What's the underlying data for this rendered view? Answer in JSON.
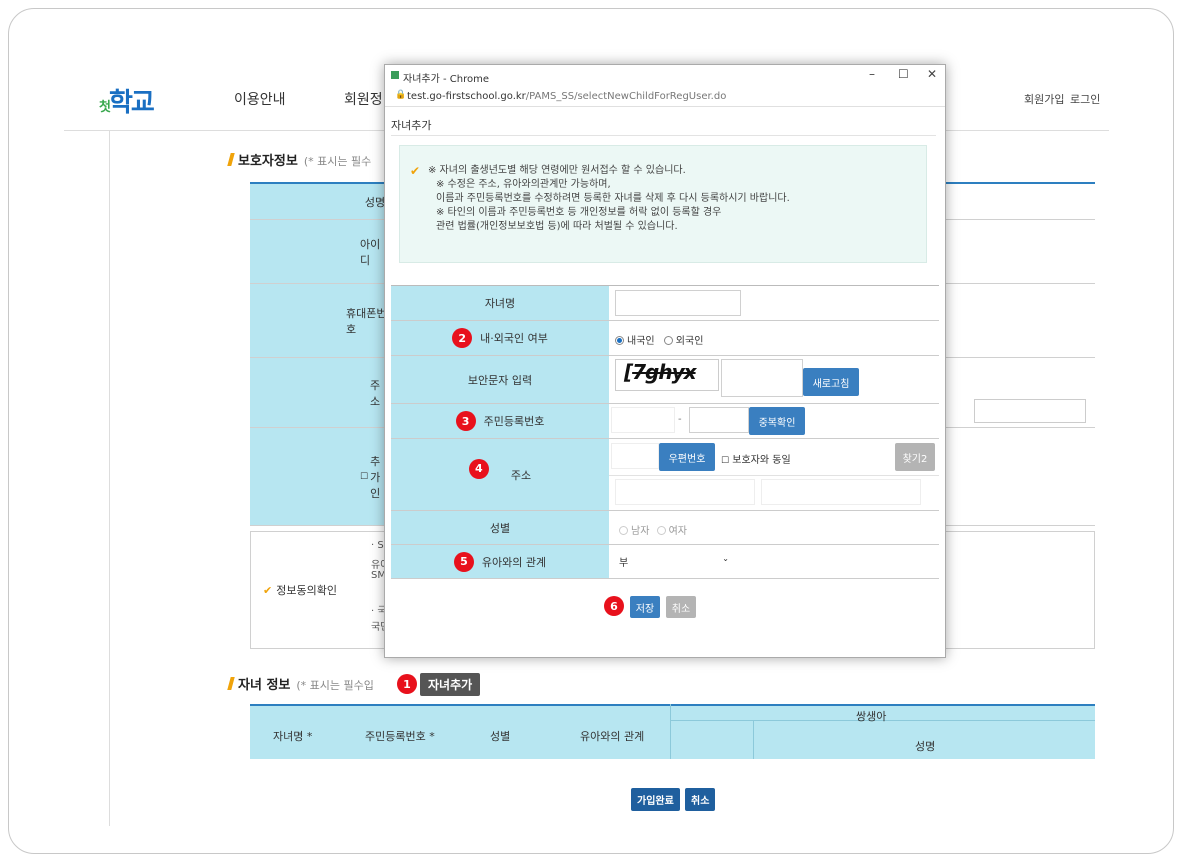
{
  "header": {
    "logo": "첫",
    "logo_main": "학교",
    "nav": [
      "이용안내",
      "회원정"
    ],
    "util": [
      "회원가입",
      "로그인"
    ]
  },
  "guardian": {
    "title": "보호자정보",
    "note": "(* 표시는 필수",
    "rows": [
      "성명",
      "아이디",
      "휴대폰번호",
      "주소",
      "추가인"
    ],
    "consent_label": "정보동의확인",
    "consent_lines": [
      "· SMS",
      "유아",
      "SMS",
      "· 국민",
      "국민"
    ]
  },
  "child": {
    "title": "자녀 정보",
    "note": "(* 표시는 필수입",
    "add_button": "자녀추가",
    "badge": "1",
    "columns": [
      "자녀명 *",
      "주민등록번호 *",
      "성별",
      "유아와의 관계",
      "쌍생아",
      "성명"
    ]
  },
  "footer": {
    "submit": "가입완료",
    "cancel": "취소"
  },
  "popup": {
    "window_title": "자녀추가 - Chrome",
    "url_host": "test.go-firstschool.go.kr",
    "url_path": "/PAMS_SS/selectNewChildForRegUser.do",
    "heading": "자녀추가",
    "notice": [
      "※ 자녀의 출생년도별 해당 연령에만 원서접수 할 수 있습니다.",
      "※ 수정은 주소, 유아와의관계만 가능하며,",
      "이름과 주민등록번호를 수정하려면 등록한 자녀를 삭제 후 다시 등록하시기 바랍니다.",
      "※ 타인의 이름과 주민등록번호 등 개인정보를 허락 없이 등록할 경우",
      "관련 법률(개인정보보호법 등)에 따라 처벌될 수 있습니다."
    ],
    "form": {
      "name_label": "자녀명",
      "nationality_label": "내·외국인 여부",
      "nationality_badge": "2",
      "nationality_options": [
        "내국인",
        "외국인"
      ],
      "captcha_label": "보안문자 입력",
      "captcha_text": "7ghyx",
      "captcha_prefix": "[",
      "refresh_button": "새로고침",
      "rrn_label": "주민등록번호",
      "rrn_badge": "3",
      "rrn_dash": "-",
      "dup_button": "중복확인",
      "address_label": "주소",
      "address_badge": "4",
      "zip_button": "우편번호",
      "same_as_guardian": "보호자와 동일",
      "find_button": "찾기2",
      "gender_label": "성별",
      "gender_options": [
        "남자",
        "여자"
      ],
      "relation_label": "유아와의 관계",
      "relation_badge": "5",
      "relation_value": "부"
    },
    "save_badge": "6",
    "save_button": "저장",
    "cancel_button": "취소"
  }
}
